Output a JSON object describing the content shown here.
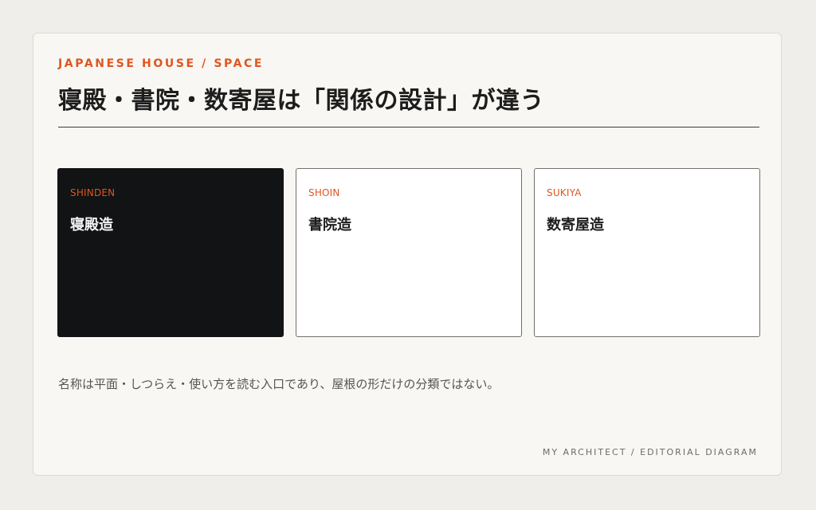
{
  "header": {
    "eyebrow": "JAPANESE HOUSE / SPACE",
    "title": "寝殿・書院・数寄屋は「関係の設計」が違う"
  },
  "tiles": [
    {
      "code": "SHINDEN",
      "name": "寝殿造",
      "style": "dark"
    },
    {
      "code": "SHOIN",
      "name": "書院造",
      "style": "light"
    },
    {
      "code": "SUKIYA",
      "name": "数寄屋造",
      "style": "light"
    }
  ],
  "note": "名称は平面・しつらえ・使い方を読む入口であり、屋根の形だけの分類ではない。",
  "footer": "MY ARCHITECT / EDITORIAL DIAGRAM",
  "colors": {
    "accent": "#e0551f",
    "dark_tile": "#111314",
    "background": "#efeeea",
    "card": "#f8f7f3"
  }
}
